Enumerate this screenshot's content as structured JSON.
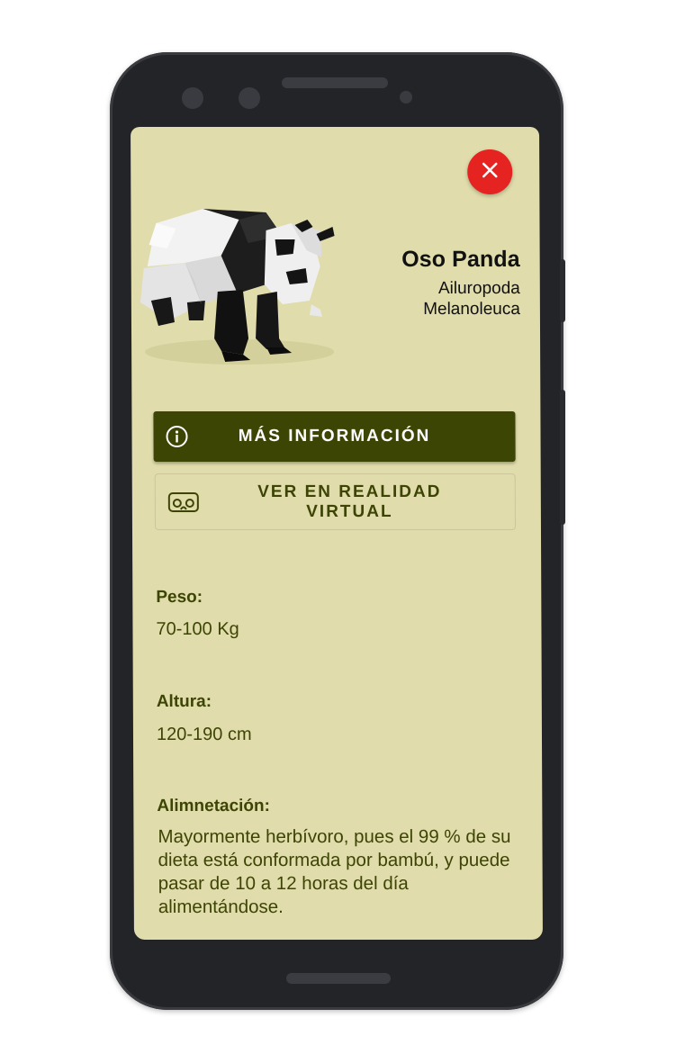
{
  "animal": {
    "name": "Oso Panda",
    "scientific_name": "Ailuropoda Melanoleuca"
  },
  "actions": {
    "more_info_label": "MÁS INFORMACIÓN",
    "vr_label": "VER EN REALIDAD VIRTUAL"
  },
  "facts": {
    "weight_label": "Peso:",
    "weight_value": "70-100 Kg",
    "height_label": "Altura:",
    "height_value": "120-190 cm",
    "diet_label": "Alimnetación:",
    "diet_value": "Mayormente herbívoro, pues el 99 % de su dieta está conformada por bambú, y puede pasar de 10 a 12 horas del día alimentándose."
  },
  "icons": {
    "close": "close-icon",
    "info": "info-icon",
    "vr": "vr-headset-icon"
  },
  "colors": {
    "background": "#e0dcab",
    "primary": "#3d4505",
    "close_button": "#e52421"
  }
}
